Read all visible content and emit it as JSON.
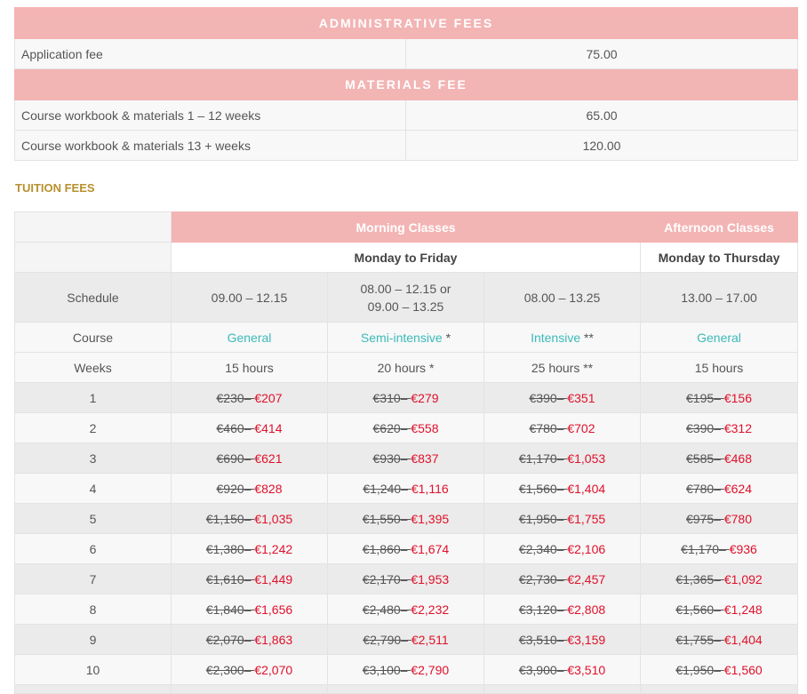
{
  "administrative": {
    "header": "ADMINISTRATIVE FEES",
    "rows": [
      {
        "label": "Application fee",
        "value": "75.00"
      }
    ]
  },
  "materials": {
    "header": "MATERIALS FEE",
    "rows": [
      {
        "label": "Course workbook & materials 1 – 12 weeks",
        "value": "65.00"
      },
      {
        "label": "Course workbook & materials 13 + weeks",
        "value": "120.00"
      }
    ]
  },
  "tuition": {
    "heading": "TUITION FEES",
    "morning_header": "Morning Classes",
    "afternoon_header": "Afternoon Classes",
    "morning_days": "Monday to Friday",
    "afternoon_days": "Monday to Thursday",
    "schedule_label": "Schedule",
    "course_label": "Course",
    "weeks_label": "Weeks",
    "columns": [
      {
        "schedule_line1": "09.00 – 12.15",
        "schedule_line2": "",
        "course": "General",
        "course_suffix": "",
        "hours": "15 hours"
      },
      {
        "schedule_line1": "08.00 – 12.15 or",
        "schedule_line2": "09.00 – 13.25",
        "course": "Semi-intensive",
        "course_suffix": " *",
        "hours": "20 hours *"
      },
      {
        "schedule_line1": "08.00 – 13.25",
        "schedule_line2": "",
        "course": "Intensive",
        "course_suffix": " **",
        "hours": "25 hours **"
      },
      {
        "schedule_line1": "13.00 – 17.00",
        "schedule_line2": "",
        "course": "General",
        "course_suffix": "",
        "hours": "15 hours"
      }
    ],
    "rows": [
      {
        "week": "1",
        "prices": [
          {
            "old": "€230",
            "new": "€207"
          },
          {
            "old": "€310",
            "new": "€279"
          },
          {
            "old": "€390",
            "new": "€351"
          },
          {
            "old": "€195",
            "new": "€156"
          }
        ]
      },
      {
        "week": "2",
        "prices": [
          {
            "old": "€460",
            "new": "€414"
          },
          {
            "old": "€620",
            "new": "€558"
          },
          {
            "old": "€780",
            "new": "€702"
          },
          {
            "old": "€390",
            "new": "€312"
          }
        ]
      },
      {
        "week": "3",
        "prices": [
          {
            "old": "€690",
            "new": "€621"
          },
          {
            "old": "€930",
            "new": "€837"
          },
          {
            "old": "€1,170",
            "new": "€1,053"
          },
          {
            "old": "€585",
            "new": "€468"
          }
        ]
      },
      {
        "week": "4",
        "prices": [
          {
            "old": "€920",
            "new": "€828"
          },
          {
            "old": "€1,240",
            "new": "€1,116"
          },
          {
            "old": "€1,560",
            "new": "€1,404"
          },
          {
            "old": "€780",
            "new": "€624"
          }
        ]
      },
      {
        "week": "5",
        "prices": [
          {
            "old": "€1,150",
            "new": "€1,035"
          },
          {
            "old": "€1,550",
            "new": "€1,395"
          },
          {
            "old": "€1,950",
            "new": "€1,755"
          },
          {
            "old": "€975",
            "new": "€780"
          }
        ]
      },
      {
        "week": "6",
        "prices": [
          {
            "old": "€1,380",
            "new": "€1,242"
          },
          {
            "old": "€1,860",
            "new": "€1,674"
          },
          {
            "old": "€2,340",
            "new": "€2,106"
          },
          {
            "old": "€1,170",
            "new": "€936"
          }
        ]
      },
      {
        "week": "7",
        "prices": [
          {
            "old": "€1,610",
            "new": "€1,449"
          },
          {
            "old": "€2,170",
            "new": "€1,953"
          },
          {
            "old": "€2,730",
            "new": "€2,457"
          },
          {
            "old": "€1,365",
            "new": "€1,092"
          }
        ]
      },
      {
        "week": "8",
        "prices": [
          {
            "old": "€1,840",
            "new": "€1,656"
          },
          {
            "old": "€2,480",
            "new": "€2,232"
          },
          {
            "old": "€3,120",
            "new": "€2,808"
          },
          {
            "old": "€1,560",
            "new": "€1,248"
          }
        ]
      },
      {
        "week": "9",
        "prices": [
          {
            "old": "€2,070",
            "new": "€1,863"
          },
          {
            "old": "€2,790",
            "new": "€2,511"
          },
          {
            "old": "€3,510",
            "new": "€3,159"
          },
          {
            "old": "€1,755",
            "new": "€1,404"
          }
        ]
      },
      {
        "week": "10",
        "prices": [
          {
            "old": "€2,300",
            "new": "€2,070"
          },
          {
            "old": "€3,100",
            "new": "€2,790"
          },
          {
            "old": "€3,900",
            "new": "€3,510"
          },
          {
            "old": "€1,950",
            "new": "€1,560"
          }
        ]
      }
    ]
  },
  "colors": {
    "header_pink": "#f3b4b4",
    "heading_gold": "#b8902e",
    "link_teal": "#3bbab9",
    "sale_red": "#e0102a"
  }
}
